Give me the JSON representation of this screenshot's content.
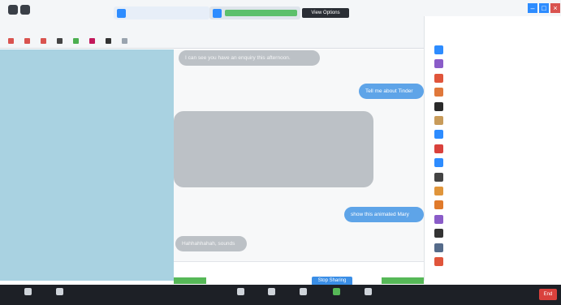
{
  "browser": {
    "tab1_title": "",
    "tab2_title": "",
    "view_options": "View Options",
    "address": "",
    "bookmarks": [
      "",
      "",
      "",
      "",
      "",
      "",
      "",
      ""
    ]
  },
  "chat": {
    "messages": [
      {
        "from": "theirs",
        "text": "I can see you have an enquiry this afternoon.",
        "meta": ""
      },
      {
        "from": "mine",
        "text": "Tell me about Tinder",
        "meta": ""
      },
      {
        "from": "theirs",
        "text": "",
        "meta": ""
      },
      {
        "from": "mine",
        "text": "show this animated Mary",
        "meta": ""
      },
      {
        "from": "theirs",
        "text": "Hahhahhahah, sounds",
        "meta": ""
      }
    ],
    "input_placeholder": "",
    "send_label": "Stop Sharing"
  },
  "participants": {
    "title": "",
    "subtitle": "",
    "rows": [
      {
        "color": "#2d8cff",
        "name": "",
        "status": ""
      },
      {
        "color": "#8a5cc8",
        "name": "",
        "status": ""
      },
      {
        "color": "#e0553b",
        "name": "",
        "status": ""
      },
      {
        "color": "#e0783b",
        "name": "",
        "status": ""
      },
      {
        "color": "#2a2a2a",
        "name": "",
        "status": ""
      },
      {
        "color": "#c89b5a",
        "name": "",
        "status": ""
      },
      {
        "color": "#2d8cff",
        "name": "",
        "status": ""
      },
      {
        "color": "#d9413c",
        "name": "",
        "status": ""
      },
      {
        "color": "#2d8cff",
        "name": "",
        "status": ""
      },
      {
        "color": "#444444",
        "name": "",
        "status": ""
      },
      {
        "color": "#e0953b",
        "name": "",
        "status": ""
      },
      {
        "color": "#e07a2b",
        "name": "",
        "status": ""
      },
      {
        "color": "#8a5cc8",
        "name": "",
        "status": ""
      },
      {
        "color": "#333333",
        "name": "",
        "status": ""
      },
      {
        "color": "#556b8a",
        "name": "",
        "status": ""
      },
      {
        "color": "#e0553b",
        "name": "",
        "status": ""
      }
    ],
    "footer": [
      "",
      "",
      ""
    ]
  },
  "toolbar": {
    "buttons": [
      "",
      "",
      "",
      "",
      "",
      "",
      "",
      "",
      "",
      ""
    ],
    "end_label": "End"
  }
}
